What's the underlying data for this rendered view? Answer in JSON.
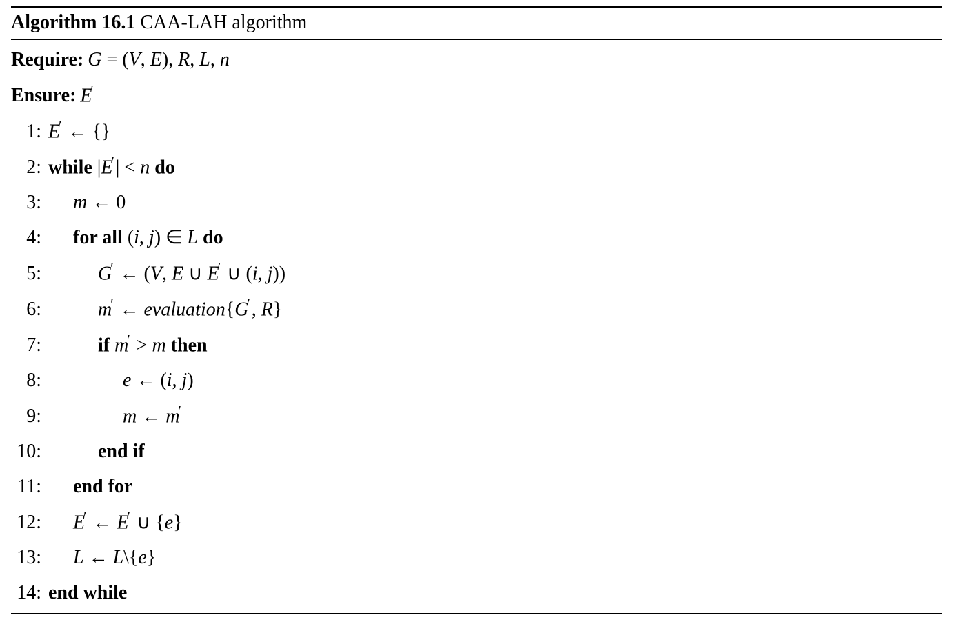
{
  "title_label": "Algorithm 16.1",
  "title_name": "CAA-LAH algorithm",
  "require_label": "Require:",
  "ensure_label": "Ensure:",
  "require_value_html": "<span class='ital'>G</span> = (<span class='ital'>V</span>, <span class='ital'>E</span>), <span class='ital'>R</span>, <span class='ital'>L</span>, <span class='ital'>n</span>",
  "ensure_value_html": "<span class='ital'>E</span><span class='prime'>′</span>",
  "lines": [
    {
      "n": "1:",
      "indent": 0,
      "html": "<span class='ital'>E</span><span class='prime'>′</span> ← {}"
    },
    {
      "n": "2:",
      "indent": 0,
      "html": "<span class='bold'>while</span> |<span class='ital'>E</span><span class='prime'>′</span>| &lt; <span class='ital'>n</span> <span class='bold'>do</span>"
    },
    {
      "n": "3:",
      "indent": 1,
      "html": "<span class='ital'>m</span> ← 0"
    },
    {
      "n": "4:",
      "indent": 1,
      "html": "<span class='bold'>for all</span> (<span class='ital'>i</span>, <span class='ital'>j</span>) ∈ <span class='ital'>L</span> <span class='bold'>do</span>"
    },
    {
      "n": "5:",
      "indent": 2,
      "html": "<span class='ital'>G</span><span class='prime'>′</span> ← (<span class='ital'>V</span>, <span class='ital'>E</span> ∪ <span class='ital'>E</span><span class='prime'>′</span> ∪ (<span class='ital'>i</span>, <span class='ital'>j</span>))"
    },
    {
      "n": "6:",
      "indent": 2,
      "html": "<span class='ital'>m</span><span class='prime'>′</span> ← <span class='ital'>evaluation</span>{<span class='ital'>G</span><span class='prime'>′</span>, <span class='ital'>R</span>}"
    },
    {
      "n": "7:",
      "indent": 2,
      "html": "<span class='bold'>if</span> <span class='ital'>m</span><span class='prime'>′</span> &gt; <span class='ital'>m</span> <span class='bold'>then</span>"
    },
    {
      "n": "8:",
      "indent": 3,
      "html": "<span class='ital'>e</span> ← (<span class='ital'>i</span>, <span class='ital'>j</span>)"
    },
    {
      "n": "9:",
      "indent": 3,
      "html": "<span class='ital'>m</span> ← <span class='ital'>m</span><span class='prime'>′</span>"
    },
    {
      "n": "10:",
      "indent": 2,
      "html": "<span class='bold'>end if</span>"
    },
    {
      "n": "11:",
      "indent": 1,
      "html": "<span class='bold'>end for</span>"
    },
    {
      "n": "12:",
      "indent": 1,
      "html": "<span class='ital'>E</span><span class='prime'>′</span> ← <span class='ital'>E</span><span class='prime'>′</span> ∪ {<span class='ital'>e</span>}"
    },
    {
      "n": "13:",
      "indent": 1,
      "html": "<span class='ital'>L</span> ← <span class='ital'>L</span>\\{<span class='ital'>e</span>}"
    },
    {
      "n": "14:",
      "indent": 0,
      "html": "<span class='bold'>end while</span>"
    }
  ]
}
